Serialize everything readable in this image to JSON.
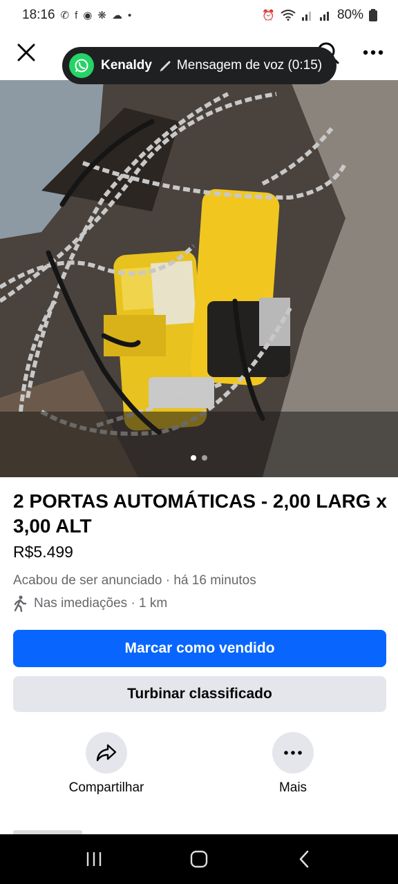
{
  "status_bar": {
    "time": "18:16",
    "battery": "80%"
  },
  "voice_message": {
    "sender": "Kenaldy",
    "text": "Mensagem de voz (0:15)"
  },
  "listing": {
    "title": "2 PORTAS  AUTOMÁTICAS - 2,00 LARG x 3,00 ALT",
    "price": "R$5.499",
    "posted": "Acabou de ser anunciado  · há 16 minutos",
    "location": "Nas imediações · 1 km",
    "photo_page": 1,
    "photo_count": 2
  },
  "buttons": {
    "mark_sold": "Marcar como vendido",
    "boost": "Turbinar classificado"
  },
  "actions": {
    "share": "Compartilhar",
    "more": "Mais"
  },
  "colors": {
    "primary": "#0866ff",
    "secondary_bg": "#e4e6eb",
    "meta_text": "#65676b",
    "whatsapp": "#25d366"
  }
}
